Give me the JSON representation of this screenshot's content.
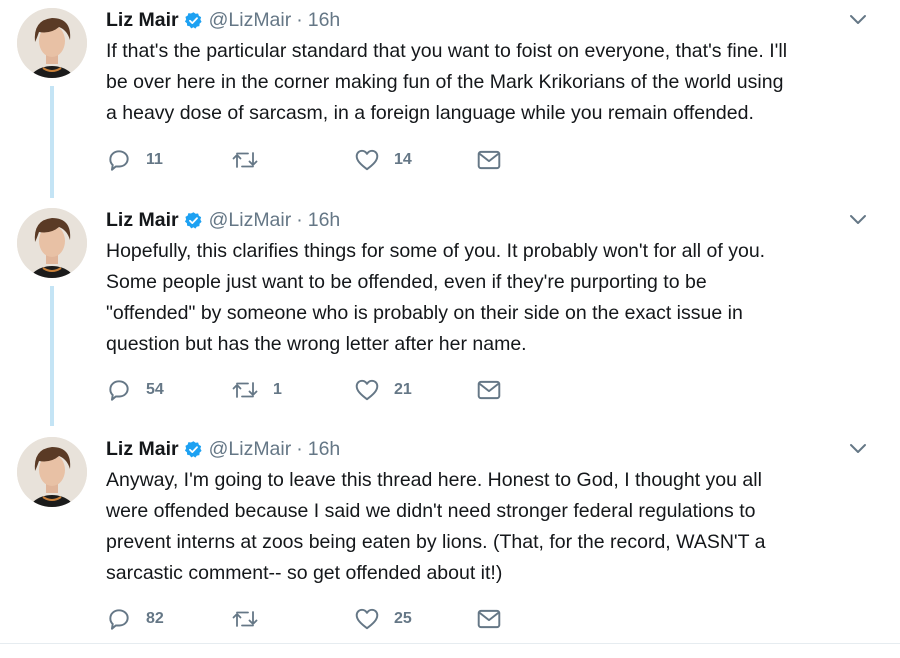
{
  "tweets": [
    {
      "name": "Liz Mair",
      "handle": "@LizMair",
      "separator": "·",
      "time": "16h",
      "text": "If that's the particular standard that you want to foist on everyone, that's fine. I'll\nbe over here in the corner making fun of the Mark Krikorians of the world using\na heavy dose of sarcasm, in a foreign language while you remain offended.",
      "replies": "11",
      "retweets": "",
      "likes": "14"
    },
    {
      "name": "Liz Mair",
      "handle": "@LizMair",
      "separator": "·",
      "time": "16h",
      "text": "Hopefully, this clarifies things for some of you. It probably won't for all of you.\nSome people just want to be offended, even if they're purporting to be\n\"offended\" by someone who is probably on their side on the exact issue in\nquestion but has the wrong letter after her name.",
      "replies": "54",
      "retweets": "1",
      "likes": "21"
    },
    {
      "name": "Liz Mair",
      "handle": "@LizMair",
      "separator": "·",
      "time": "16h",
      "text": "Anyway, I'm going to leave this thread here. Honest to God, I thought you all\nwere offended because I said we didn't need stronger federal regulations to\nprevent interns at zoos being eaten by lions. (That, for the record, WASN'T a\nsarcastic comment-- so get offended about it!)",
      "replies": "82",
      "retweets": "",
      "likes": "25"
    }
  ],
  "icons": {
    "verified": "verified-badge-icon",
    "caret": "chevron-down-icon",
    "reply": "reply-bubble-icon",
    "retweet": "retweet-icon",
    "like": "heart-icon",
    "dm": "envelope-icon"
  },
  "colors": {
    "thread_line": "#c4e4f5",
    "verified": "#1da1f2",
    "secondary_text": "#657786",
    "primary_text": "#14171a"
  }
}
